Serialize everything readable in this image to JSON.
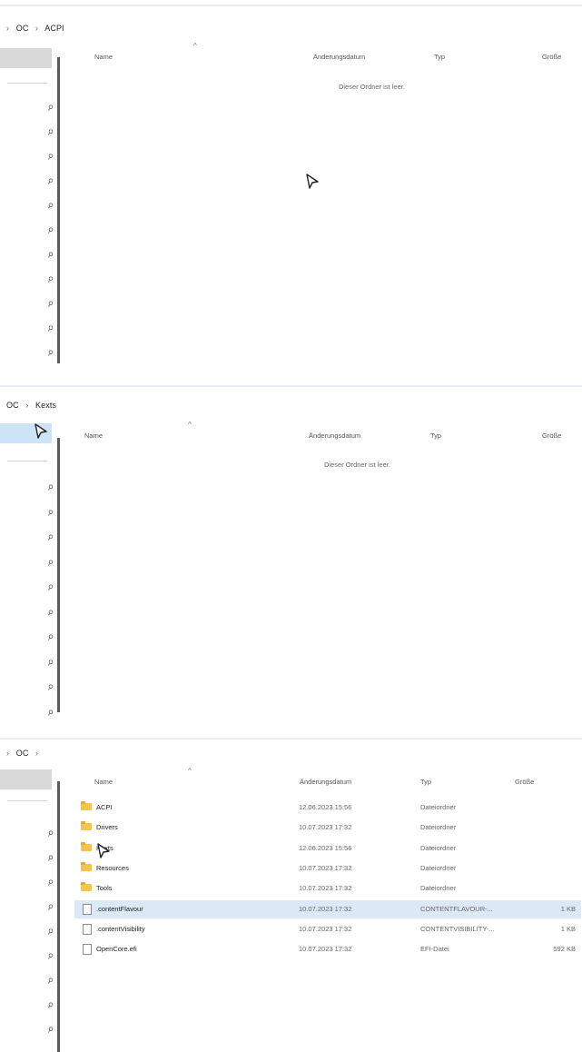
{
  "panels": [
    {
      "breadcrumb": {
        "lead": "›",
        "items": [
          "OC",
          "ACPI"
        ]
      },
      "columns": {
        "name": "Name",
        "date": "Änderungsdatum",
        "type": "Typ",
        "size": "Größe"
      },
      "empty_message": "Dieser Ordner ist leer."
    },
    {
      "breadcrumb": {
        "lead": "",
        "items": [
          "OC",
          "Kexts"
        ]
      },
      "columns": {
        "name": "Name",
        "date": "Änderungsdatum",
        "type": "Typ",
        "size": "Größe"
      },
      "empty_message": "Dieser Ordner ist leer."
    },
    {
      "breadcrumb": {
        "lead": "›",
        "items": [
          "OC",
          ""
        ]
      },
      "columns": {
        "name": "Name",
        "date": "Änderungsdatum",
        "type": "Typ",
        "size": "Größe"
      },
      "rows": [
        {
          "icon": "folder-icon",
          "name": "ACPI",
          "date": "12.06.2023 15:56",
          "type": "Dateiordner",
          "size": ""
        },
        {
          "icon": "folder-icon",
          "name": "Drivers",
          "date": "10.07.2023 17:32",
          "type": "Dateiordner",
          "size": ""
        },
        {
          "icon": "folder-icon",
          "name": "Kexts",
          "date": "12.06.2023 15:56",
          "type": "Dateiordner",
          "size": ""
        },
        {
          "icon": "folder-icon",
          "name": "Resources",
          "date": "10.07.2023 17:32",
          "type": "Dateiordner",
          "size": ""
        },
        {
          "icon": "folder-icon",
          "name": "Tools",
          "date": "10.07.2023 17:32",
          "type": "Dateiordner",
          "size": ""
        },
        {
          "icon": "file-icon",
          "name": ".contentFlavour",
          "date": "10.07.2023 17:32",
          "type": "CONTENTFLAVOUR-...",
          "size": "1 KB"
        },
        {
          "icon": "file-icon",
          "name": ".contentVisibility",
          "date": "10.07.2023 17:32",
          "type": "CONTENTVISIBILITY-...",
          "size": "1 KB"
        },
        {
          "icon": "file-icon",
          "name": "OpenCore.efi",
          "date": "10.07.2023 17:32",
          "type": "EFI-Datei",
          "size": "592 KB"
        }
      ]
    }
  ],
  "pin_icon": "pin-icon",
  "cursor_icon": "mouse-cursor-icon",
  "colors": {
    "folder": "#f3c44f",
    "selection": "#dbe9f7",
    "nav_selected": "#cde4f7"
  }
}
